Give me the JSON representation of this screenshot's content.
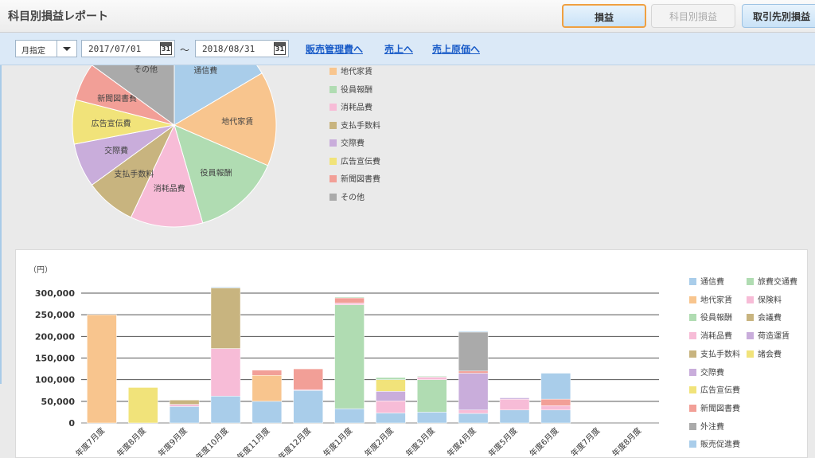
{
  "header": {
    "title": "科目別損益レポート",
    "buttons": [
      "損益",
      "科目別損益",
      "取引先別損益"
    ]
  },
  "filter": {
    "period_mode": "月指定",
    "date_from": "2017/07/01",
    "range_sep": "～",
    "date_to": "2018/08/31",
    "calendar_glyph": "31",
    "links": [
      "販売管理費へ",
      "売上へ",
      "売上原価へ"
    ]
  },
  "pie": {
    "slices": [
      {
        "label": "通信費",
        "value": 16.5,
        "color": "#a9cdea"
      },
      {
        "label": "地代家賃",
        "value": 15,
        "color": "#f8c58e"
      },
      {
        "label": "役員報酬",
        "value": 14,
        "color": "#b0dcb2"
      },
      {
        "label": "消耗品費",
        "value": 11.5,
        "color": "#f7bcd7"
      },
      {
        "label": "支払手数料",
        "value": 8,
        "color": "#c8b47f"
      },
      {
        "label": "交際費",
        "value": 7,
        "color": "#c9addb"
      },
      {
        "label": "広告宣伝費",
        "value": 7,
        "color": "#f1e37a"
      },
      {
        "label": "新聞図書費",
        "value": 6,
        "color": "#f29f97"
      },
      {
        "label": "その他",
        "value": 15,
        "color": "#aaaaaa"
      }
    ],
    "legend": [
      {
        "label": "地代家賃",
        "color": "#f8c58e"
      },
      {
        "label": "役員報酬",
        "color": "#b0dcb2"
      },
      {
        "label": "消耗品費",
        "color": "#f7bcd7"
      },
      {
        "label": "支払手数料",
        "color": "#c8b47f"
      },
      {
        "label": "交際費",
        "color": "#c9addb"
      },
      {
        "label": "広告宣伝費",
        "color": "#f1e37a"
      },
      {
        "label": "新聞図書費",
        "color": "#f29f97"
      },
      {
        "label": "その他",
        "color": "#aaaaaa"
      }
    ]
  },
  "bar_chart": {
    "unit_label": "（円）"
  },
  "chart_data": {
    "type": "bar",
    "stacked": true,
    "ylabel": "（円）",
    "ylim": [
      0,
      300000
    ],
    "yticks": [
      "0",
      "50,000",
      "100,000",
      "150,000",
      "200,000",
      "250,000",
      "300,000"
    ],
    "categories": [
      "年度7月度",
      "年度8月度",
      "年度9月度",
      "年度10月度",
      "年度11月度",
      "年度12月度",
      "年度1月度",
      "年度2月度",
      "年度3月度",
      "年度4月度",
      "年度5月度",
      "年度6月度",
      "年度7月度",
      "年度8月度"
    ],
    "series": [
      {
        "name": "通信費",
        "color": "#a9cdea",
        "values": [
          0,
          0,
          38000,
          62000,
          50000,
          75000,
          33000,
          23000,
          25000,
          22000,
          30000,
          30000,
          0,
          0
        ]
      },
      {
        "name": "地代家賃",
        "color": "#f8c58e",
        "values": [
          250000,
          0,
          0,
          0,
          60000,
          0,
          0,
          0,
          0,
          0,
          0,
          0,
          0,
          0
        ]
      },
      {
        "name": "役員報酬",
        "color": "#b0dcb2",
        "values": [
          0,
          0,
          0,
          0,
          0,
          0,
          240000,
          0,
          75000,
          0,
          0,
          0,
          0,
          0
        ]
      },
      {
        "name": "消耗品費",
        "color": "#f7bcd7",
        "values": [
          0,
          0,
          5000,
          110000,
          0,
          2000,
          4000,
          28000,
          6000,
          8000,
          25000,
          10000,
          0,
          0
        ]
      },
      {
        "name": "支払手数料",
        "color": "#c8b47f",
        "values": [
          0,
          0,
          10000,
          140000,
          0,
          0,
          0,
          0,
          0,
          0,
          0,
          0,
          0,
          0
        ]
      },
      {
        "name": "交際費",
        "color": "#c9addb",
        "values": [
          0,
          0,
          0,
          0,
          0,
          0,
          0,
          22000,
          0,
          85000,
          3000,
          0,
          0,
          0
        ]
      },
      {
        "name": "広告宣伝費",
        "color": "#f1e37a",
        "values": [
          0,
          82000,
          0,
          0,
          0,
          0,
          0,
          27000,
          0,
          0,
          0,
          0,
          0,
          0
        ]
      },
      {
        "name": "新聞図書費",
        "color": "#f29f97",
        "values": [
          0,
          0,
          0,
          0,
          12000,
          48000,
          12000,
          0,
          0,
          5000,
          0,
          15000,
          0,
          0
        ]
      },
      {
        "name": "外注費",
        "color": "#aaaaaa",
        "values": [
          0,
          0,
          0,
          0,
          0,
          0,
          0,
          0,
          0,
          90000,
          0,
          0,
          0,
          0
        ]
      },
      {
        "name": "旅費交通費",
        "color": "#b0dcb2",
        "values": [
          0,
          0,
          0,
          0,
          0,
          0,
          2000,
          5000,
          2000,
          0,
          0,
          0,
          0,
          0
        ]
      },
      {
        "name": "保険料",
        "color": "#f7bcd7",
        "values": [
          0,
          0,
          0,
          0,
          0,
          0,
          0,
          0,
          0,
          0,
          0,
          0,
          0,
          0
        ]
      },
      {
        "name": "会議費",
        "color": "#c8b47f",
        "values": [
          0,
          0,
          0,
          0,
          0,
          0,
          0,
          0,
          0,
          0,
          0,
          0,
          0,
          0
        ]
      },
      {
        "name": "荷造運賃",
        "color": "#c9addb",
        "values": [
          0,
          0,
          0,
          0,
          0,
          0,
          0,
          0,
          0,
          0,
          0,
          0,
          0,
          0
        ]
      },
      {
        "name": "諸会費",
        "color": "#f1e37a",
        "values": [
          0,
          0,
          0,
          0,
          0,
          0,
          0,
          0,
          0,
          0,
          0,
          0,
          0,
          0
        ]
      },
      {
        "name": "販売促進費",
        "color": "#a9cdea",
        "values": [
          0,
          0,
          0,
          2000,
          0,
          0,
          0,
          0,
          0,
          2000,
          0,
          60000,
          0,
          0
        ]
      }
    ],
    "legend": [
      {
        "label": "通信費",
        "color": "#a9cdea"
      },
      {
        "label": "旅費交通費",
        "color": "#b0dcb2"
      },
      {
        "label": "地代家賃",
        "color": "#f8c58e"
      },
      {
        "label": "保険料",
        "color": "#f7bcd7"
      },
      {
        "label": "役員報酬",
        "color": "#b0dcb2"
      },
      {
        "label": "会議費",
        "color": "#c8b47f"
      },
      {
        "label": "消耗品費",
        "color": "#f7bcd7"
      },
      {
        "label": "荷造運賃",
        "color": "#c9addb"
      },
      {
        "label": "支払手数料",
        "color": "#c8b47f"
      },
      {
        "label": "諸会費",
        "color": "#f1e37a"
      },
      {
        "label": "交際費",
        "color": "#c9addb"
      },
      {
        "label": "広告宣伝費",
        "color": "#f1e37a"
      },
      {
        "label": "新聞図書費",
        "color": "#f29f97"
      },
      {
        "label": "外注費",
        "color": "#aaaaaa"
      },
      {
        "label": "販売促進費",
        "color": "#a9cdea"
      }
    ]
  }
}
